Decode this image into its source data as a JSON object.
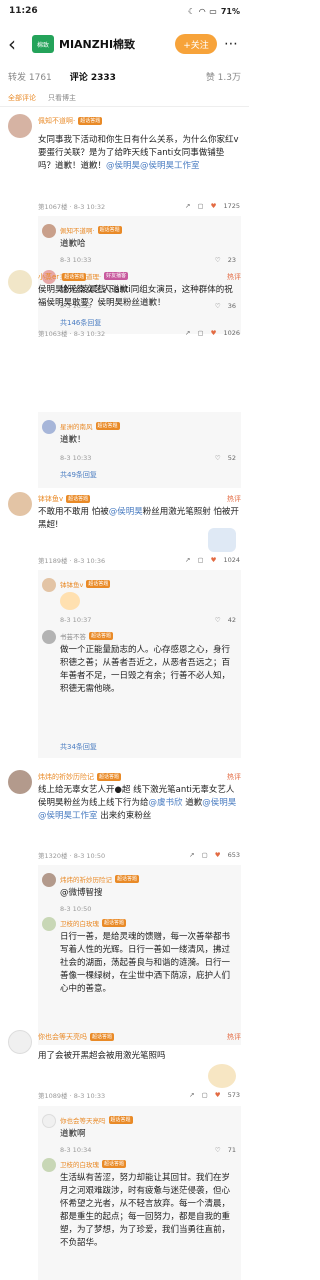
{
  "status": {
    "time": "11:26",
    "battery": "71%"
  },
  "header": {
    "title": "MIANZHI棉致",
    "follow": "+关注",
    "logo_text": "棉致"
  },
  "tabs": {
    "repost": "转发 1761",
    "comment": "评论 2333",
    "like": "赞 1.3万"
  },
  "sort": {
    "all": "全部评论",
    "blogger": "只看博主"
  },
  "colors": {
    "accent": "#e98a27",
    "follow_bg": "#f7a33a",
    "link": "#4a7cc1",
    "logo_bg": "#24a35a"
  },
  "comments": [
    {
      "user": "佩知不道啊·",
      "badge": "超话答题",
      "text_plain": "女同事我下活动和你生日有什么关系，为什么你家红v要蛋行关联？是为了给昨天线下anti女同事做铺垫吗？道歉！道歉！",
      "text_at1": "@侯明昊",
      "text_at2": "@侯明昊工作室",
      "meta": "第1067楼 · 8-3 10:32",
      "likes": "1725",
      "replies": [
        {
          "user": "佩知不道啊·",
          "badge": "超话答题",
          "text": "道歉哈",
          "meta": "8-3 10:33",
          "likes": "23"
        },
        {
          "user": "菜有菜的道理·",
          "badge": "好友播客",
          "text": "给无辜女艺人道歉",
          "meta": "8-3 10:33",
          "likes": "36"
        }
      ],
      "more": "共146条回复"
    },
    {
      "user": "小蒸er",
      "badge": "超话答题",
      "hot": "热评",
      "text": "侯明昊粉丝凌晨线下anti同组女演员，这种群体的祝福侯明昊敢要？侯明昊粉丝道歉！",
      "meta": "第1063楼 · 8-3 10:32",
      "likes": "1026",
      "replies": [
        {
          "user": "星洲的南风",
          "badge": "超话答题",
          "text": "道歉！",
          "meta": "8-3 10:33",
          "likes": "52"
        }
      ],
      "more": "共49条回复"
    },
    {
      "user": "钵钵鱼v",
      "badge": "超话答题",
      "hot": "热评",
      "text_pre": "不敢用不敢用 怕被",
      "text_at": "@侯明昊",
      "text_post": "粉丝用激光笔照射 怕被开黑超!",
      "meta": "第1189楼 · 8-3 10:36",
      "likes": "1024",
      "replies": [
        {
          "user": "钵钵鱼v",
          "badge": "超话答题",
          "text": "",
          "meta": "8-3 10:37",
          "likes": "42"
        },
        {
          "user": "书芸不答",
          "badge": "超话答题",
          "text": "做一个正能量励志的人。心存感恩之心，身行积德之善；从善者吾近之，从恶者吾远之；百年善者不足，一日毁之有余；行善不必人知，积德无需他晓。",
          "meta": "",
          "likes": ""
        }
      ],
      "more": "共34条回复"
    },
    {
      "user": "炜炜的祈妙历险记",
      "badge": "超话答题",
      "hot": "热评",
      "text_pre": "线上给无辜女艺人开●超 线下激光笔anti无辜女艺人 侯明昊粉丝为线上线下行为给",
      "text_at0": "@虞书欣",
      "text_mid": " 道歉",
      "text_at1": "@侯明昊",
      "text_at2": "@侯明昊工作室",
      "text_post": " 出来约束粉丝",
      "meta": "第1320楼 · 8-3 10:50",
      "likes": "653",
      "replies": [
        {
          "user": "炜炜的祈妙历险记",
          "badge": "超话答题",
          "text": "@微博智搜",
          "meta": "8-3 10:50",
          "likes": ""
        },
        {
          "user": "卫枝的白玫瑰",
          "badge": "超话答题",
          "text": "日行一善，是给灵魂的馈赠，每一次善举都书写着人性的光辉。日行一善如一缕清风，拂过社会的湖面，荡起善良与和谐的涟漪。日行一善像一棵绿树，在尘世中洒下荫凉，庇护人们心中的善意。",
          "meta": "",
          "likes": ""
        }
      ],
      "more": "共43条回复"
    },
    {
      "user": "你也会等天亮吗",
      "badge": "超话答题",
      "hot": "热评",
      "text": "用了会被开黑超会被用激光笔照吗",
      "meta": "第1089楼 · 8-3 10:33",
      "likes": "573",
      "replies": [
        {
          "user": "你也会等天亮吗",
          "badge": "超话答题",
          "text": "道歉啊",
          "meta": "8-3 10:34",
          "likes": "71"
        },
        {
          "user": "卫枝的白玫瑰",
          "badge": "超话答题",
          "text": "生活纵有苦涩，努力却能让其回甘。我们在岁月之河艰难跋涉，时有疲惫与迷茫侵袭，但心怀希望之光者，从不轻言放弃。每一个清晨，都是重生的起点；每一回努力，都是自我的重塑，为了梦想，为了珍爱，我们当勇往直前，不负韶华。",
          "meta": "",
          "likes": ""
        }
      ],
      "more": ""
    }
  ]
}
